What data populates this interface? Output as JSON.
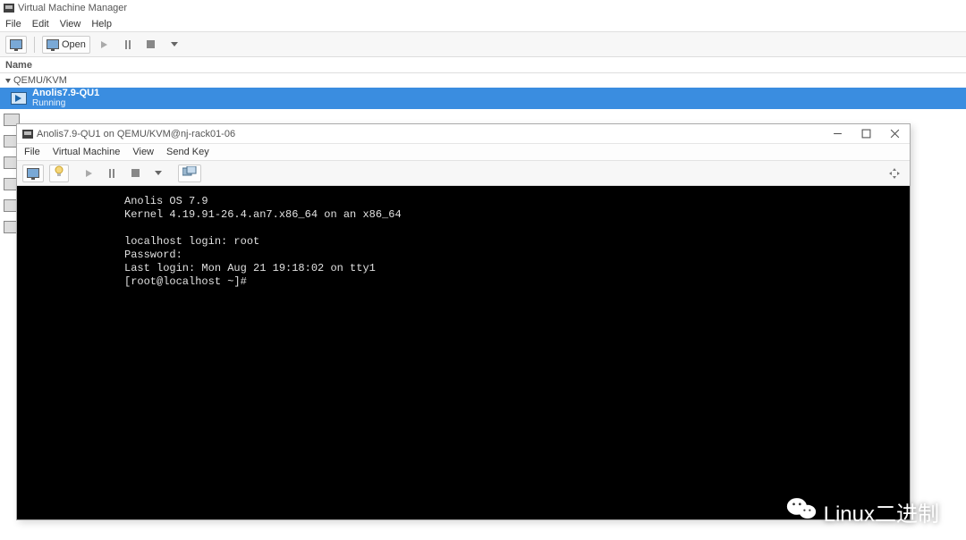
{
  "main_window": {
    "title": "Virtual Machine Manager",
    "menubar": {
      "file": "File",
      "edit": "Edit",
      "view": "View",
      "help": "Help"
    },
    "toolbar": {
      "open": "Open"
    },
    "list_header": "Name",
    "group": {
      "label": "QEMU/KVM"
    },
    "vm": {
      "name": "Anolis7.9-QU1",
      "state": "Running"
    }
  },
  "console_window": {
    "title": "Anolis7.9-QU1 on QEMU/KVM@nj-rack01-06",
    "menubar": {
      "file": "File",
      "vm": "Virtual Machine",
      "view": "View",
      "sendkey": "Send Key"
    },
    "terminal_lines": [
      "Anolis OS 7.9",
      "Kernel 4.19.91-26.4.an7.x86_64 on an x86_64",
      "",
      "localhost login: root",
      "Password:",
      "Last login: Mon Aug 21 19:18:02 on tty1",
      "[root@localhost ~]#"
    ]
  },
  "watermark": {
    "text": "Linux二进制"
  }
}
